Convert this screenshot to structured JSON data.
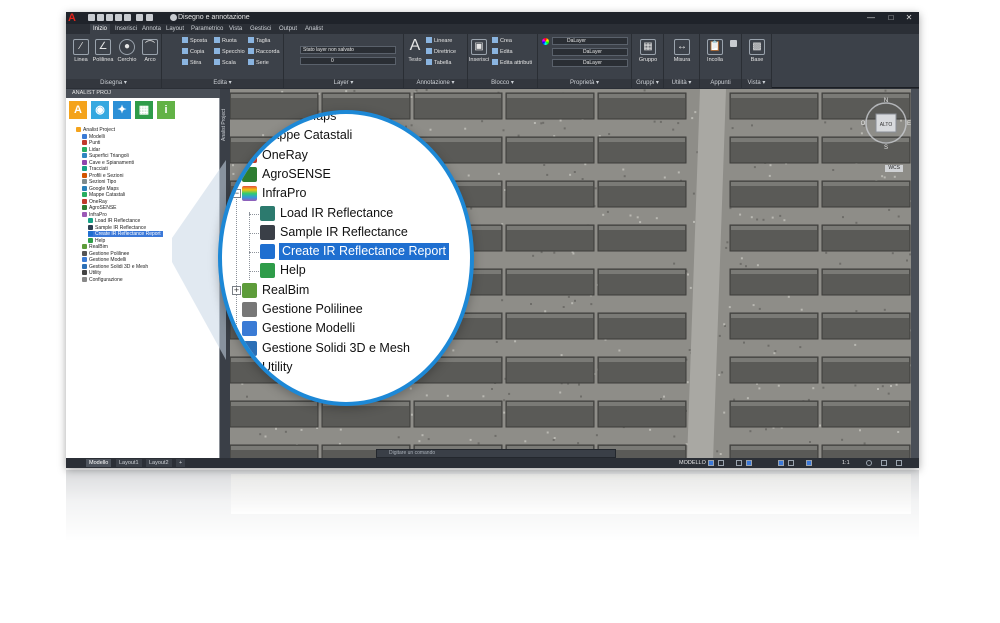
{
  "app": {
    "logo": "A",
    "document_title": "Disegno e annotazione",
    "window_controls": [
      "minimize-icon",
      "restore-icon",
      "close-icon"
    ]
  },
  "ribbon_tabs": [
    "Inizio",
    "Inserisci",
    "Annota",
    "Layout",
    "Parametrico",
    "Vista",
    "Gestisci",
    "Output",
    "Analist"
  ],
  "ribbon": {
    "disegna": {
      "title": "Disegna ▾",
      "buttons": [
        "Linea",
        "Polilinea",
        "Cerchio",
        "Arco"
      ]
    },
    "edita": {
      "title": "Edita ▾",
      "items": [
        "Sposta",
        "Ruota",
        "Taglia",
        "Copia",
        "Specchio",
        "Raccorda",
        "Stira",
        "Scala",
        "Serie"
      ]
    },
    "layer": {
      "title": "Layer ▾",
      "state": "Stato layer non salvato",
      "current": "0"
    },
    "annotazione": {
      "title": "Annotazione ▾",
      "text_button": "Testo",
      "items": [
        "Lineare",
        "Direttrice",
        "Tabella"
      ]
    },
    "blocco": {
      "title": "Blocco ▾",
      "insert_button": "Inserisci",
      "items": [
        "Crea",
        "Edita",
        "Edita attributi"
      ]
    },
    "proprieta": {
      "title": "Proprietà ▾",
      "values": [
        "DaLayer",
        "DaLayer",
        "DaLayer"
      ]
    },
    "gruppi": {
      "title": "Gruppi ▾",
      "button": "Gruppo"
    },
    "utilita": {
      "title": "Utilità ▾",
      "button": "Misura"
    },
    "appunti": {
      "title": "Appunti",
      "button": "Incolla"
    },
    "vista": {
      "title": "Vista ▾",
      "button": "Base"
    }
  },
  "palette": {
    "title": "ANALIST PROJ",
    "side_label": "Analist Project",
    "toolbar_icons": [
      "analist-icon",
      "globe-icon",
      "satellite-icon",
      "map-icon",
      "info-icon"
    ],
    "tree": [
      "Analist Project",
      "Modelli",
      "Punti",
      "Lidar",
      "Superfici Triangoli",
      "Cave e Spianamenti",
      "Tracciati",
      "Profili e Sezioni",
      "Sezioni Tipo",
      "Google Maps",
      "Mappe Catastali",
      "OneRay",
      "AgroSENSE",
      "InfraPro",
      "Load IR Reflectance",
      "Sample IR Reflectance",
      "Create IR Reflectance Report",
      "Help",
      "RealBim",
      "Gestione Polilinee",
      "Gestione Modelli",
      "Gestione Solidi 3D e Mesh",
      "Utility",
      "Configurazione"
    ],
    "selected": "Create IR Reflectance Report"
  },
  "magnifier": {
    "items": [
      "Google Maps",
      "Mappe Catastali",
      "OneRay",
      "AgroSENSE",
      "InfraPro",
      "Load IR Reflectance",
      "Sample IR Reflectance",
      "Create IR Reflectance Report",
      "Help",
      "RealBim",
      "Gestione Polilinee",
      "Gestione Modelli",
      "Gestione Solidi 3D e Mesh",
      "Utility"
    ],
    "selected": "Create IR Reflectance Report"
  },
  "viewcube": {
    "north": "N",
    "south": "S",
    "east": "E",
    "west": "O",
    "face": "ALTO",
    "ucs": "WCS"
  },
  "command_line": {
    "placeholder": "Digitare un comando"
  },
  "layout_tabs": [
    "Modello",
    "Layout1",
    "Layout2",
    "+"
  ],
  "status": {
    "mode": "MODELLO",
    "scale": "1:1"
  },
  "colors": {
    "accent": "#1d88d6",
    "selection": "#1f6fd0",
    "ribbon_bg": "#3c4149",
    "titlebar_bg": "#1f232a"
  }
}
